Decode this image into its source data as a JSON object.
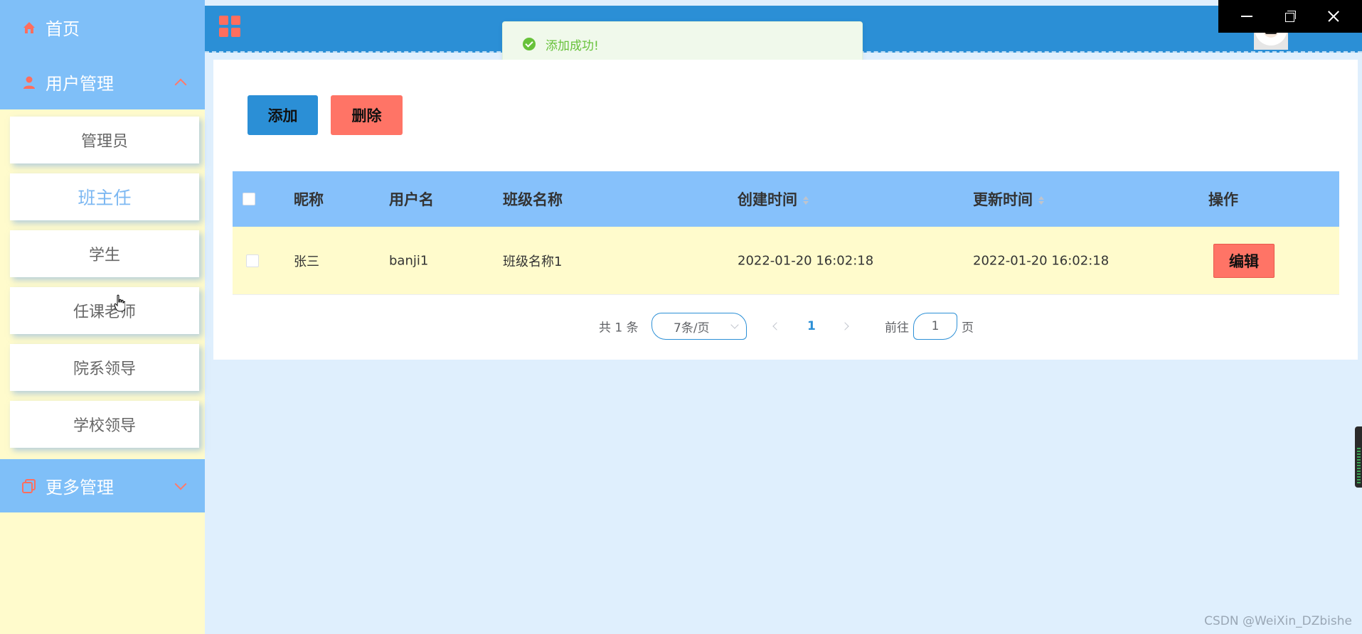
{
  "sidebar": {
    "home_label": "首页",
    "user_mgmt_label": "用户管理",
    "more_mgmt_label": "更多管理",
    "sub_items": [
      {
        "label": "管理员",
        "active": false
      },
      {
        "label": "班主任",
        "active": true
      },
      {
        "label": "学生",
        "active": false
      },
      {
        "label": "任课老师",
        "active": false
      },
      {
        "label": "院系领导",
        "active": false
      },
      {
        "label": "学校领导",
        "active": false
      }
    ]
  },
  "toast": {
    "message": "添加成功!"
  },
  "toolbar": {
    "add_label": "添加",
    "delete_label": "删除"
  },
  "table": {
    "headers": {
      "nickname": "昵称",
      "username": "用户名",
      "class_name": "班级名称",
      "created": "创建时间",
      "updated": "更新时间",
      "actions": "操作"
    },
    "rows": [
      {
        "nickname": "张三",
        "username": "banji1",
        "class_name": "班级名称1",
        "created": "2022-01-20 16:02:18",
        "updated": "2022-01-20 16:02:18",
        "edit_label": "编辑"
      }
    ]
  },
  "pagination": {
    "total_text": "共 1 条",
    "page_size_text": "7条/页",
    "current_page": "1",
    "goto_prefix": "前往",
    "goto_value": "1",
    "goto_suffix": "页"
  },
  "watermark": "CSDN @WeiXin_DZbishe",
  "colors": {
    "sidebar_blue": "#7fbff8",
    "sidebar_bg": "#fffbcc",
    "header_blue": "#2b8fd6",
    "danger": "#ff7466",
    "success": "#67c23a",
    "page_bg": "#dfeffd"
  }
}
